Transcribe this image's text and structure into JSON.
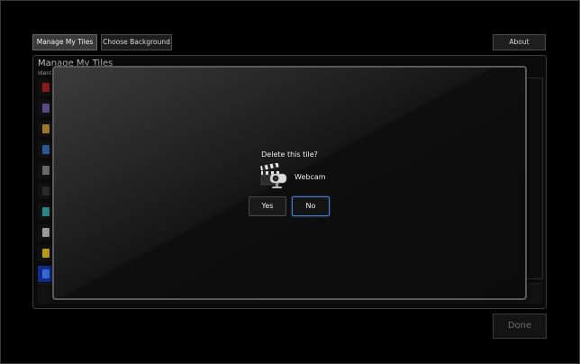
{
  "toolbar": {
    "manage_label": "Manage My Tiles",
    "background_label": "Choose Background",
    "about_label": "About"
  },
  "panel": {
    "title": "Manage My Tiles",
    "subtitle": "Ident"
  },
  "tiles": [
    {
      "icon": "tile-icon-red",
      "color": "#8a1c1c"
    },
    {
      "icon": "tile-icon-purple",
      "color": "#5a4a8a"
    },
    {
      "icon": "tile-icon-gold",
      "color": "#a07a2a"
    },
    {
      "icon": "tile-icon-blue",
      "color": "#2a5a9a"
    },
    {
      "icon": "tile-icon-gray",
      "color": "#6a6a6a"
    },
    {
      "icon": "tile-icon-dark",
      "color": "#2a2a2a"
    },
    {
      "icon": "tile-icon-teal",
      "color": "#2a8a8a"
    },
    {
      "icon": "tile-icon-white",
      "color": "#9a9a9a"
    },
    {
      "icon": "tile-icon-yellow",
      "color": "#b89a1a"
    },
    {
      "icon": "tile-icon-selected",
      "color": "#3a6ad0"
    }
  ],
  "dialog": {
    "question": "Delete this tile?",
    "tile_name": "Webcam",
    "tile_icon": "webcam-clapper-icon",
    "yes_label": "Yes",
    "no_label": "No"
  },
  "footer": {
    "done_label": "Done"
  },
  "colors": {
    "background": "#000000",
    "focus_border": "#4a7ec8",
    "selected_tile": "#0f2c8a"
  }
}
